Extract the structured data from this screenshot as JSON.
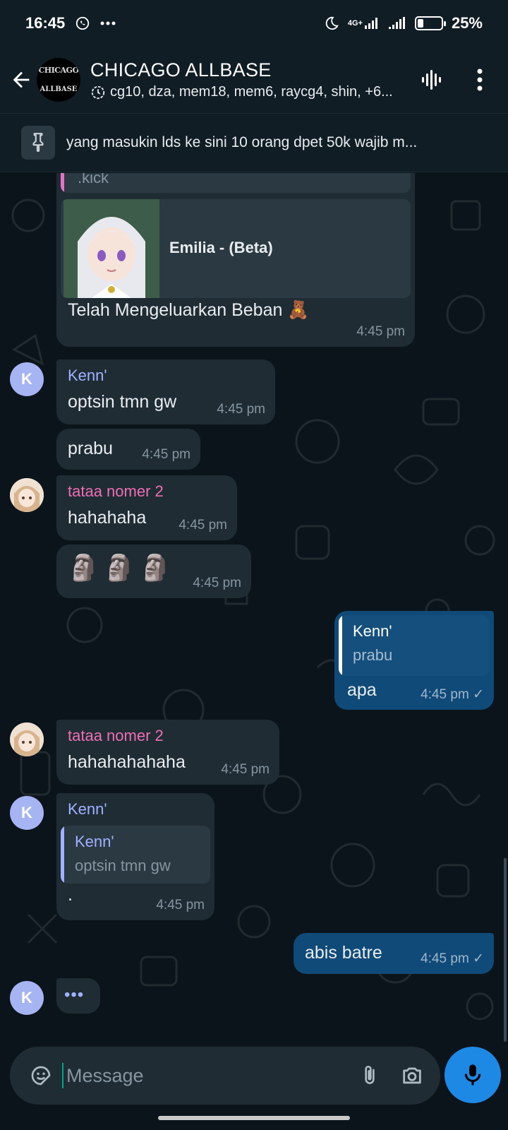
{
  "status_bar": {
    "time": "16:45",
    "network": "4G+",
    "battery_percent": "25%",
    "battery_level": 0.25
  },
  "header": {
    "title": "CHICAGO ALLBASE",
    "members": "cg10, dza, mem18, mem6, raycg4, shin, +6...",
    "avatar_logo_text": "CHICAGO",
    "avatar_logo_sub": "ALLBASE"
  },
  "pinned": {
    "text": "yang masukin lds ke sini 10 orang dpet 50k wajib m..."
  },
  "messages": {
    "m1": {
      "quote_text": ".kick",
      "link_title": "Emilia - (Beta)",
      "text": "Telah Mengeluarkan Beban 🧸",
      "time": "4:45 pm"
    },
    "m2": {
      "sender": "Kenn'",
      "avatar": "K",
      "text": "optsin tmn gw",
      "time": "4:45 pm"
    },
    "m3": {
      "text": "prabu",
      "time": "4:45 pm"
    },
    "m4": {
      "sender": "tataa nomer 2",
      "text": "hahahaha",
      "time": "4:45 pm"
    },
    "m5": {
      "text": "🗿🗿🗿",
      "time": "4:45 pm"
    },
    "m6": {
      "quote_name": "Kenn'",
      "quote_text": "prabu",
      "text": "apa",
      "time": "4:45 pm ✓"
    },
    "m7": {
      "sender": "tataa nomer 2",
      "text": "hahahahahaha",
      "time": "4:45 pm"
    },
    "m8": {
      "sender": "Kenn'",
      "avatar": "K",
      "quote_name": "Kenn'",
      "quote_text": "optsin tmn gw",
      "text": ".",
      "time": "4:45 pm"
    },
    "m9": {
      "text": "abis batre",
      "time": "4:45 pm ✓"
    },
    "typing": {
      "avatar": "K",
      "dots": "•••"
    }
  },
  "composer": {
    "placeholder": "Message"
  },
  "colors": {
    "kenn_name": "#9fb2ff",
    "tataa_name": "#ee6fb5",
    "outgoing_bubble": "#0f4a78",
    "incoming_bubble": "#1f2c34",
    "mic_button": "#1e88e5"
  },
  "icons": {
    "back": "arrow-left-icon",
    "voice_chat": "sound-wave-icon",
    "menu": "more-vertical-icon",
    "pin": "pin-icon",
    "sticker": "sticker-icon",
    "attach": "paperclip-icon",
    "camera": "camera-icon",
    "mic": "microphone-icon"
  }
}
